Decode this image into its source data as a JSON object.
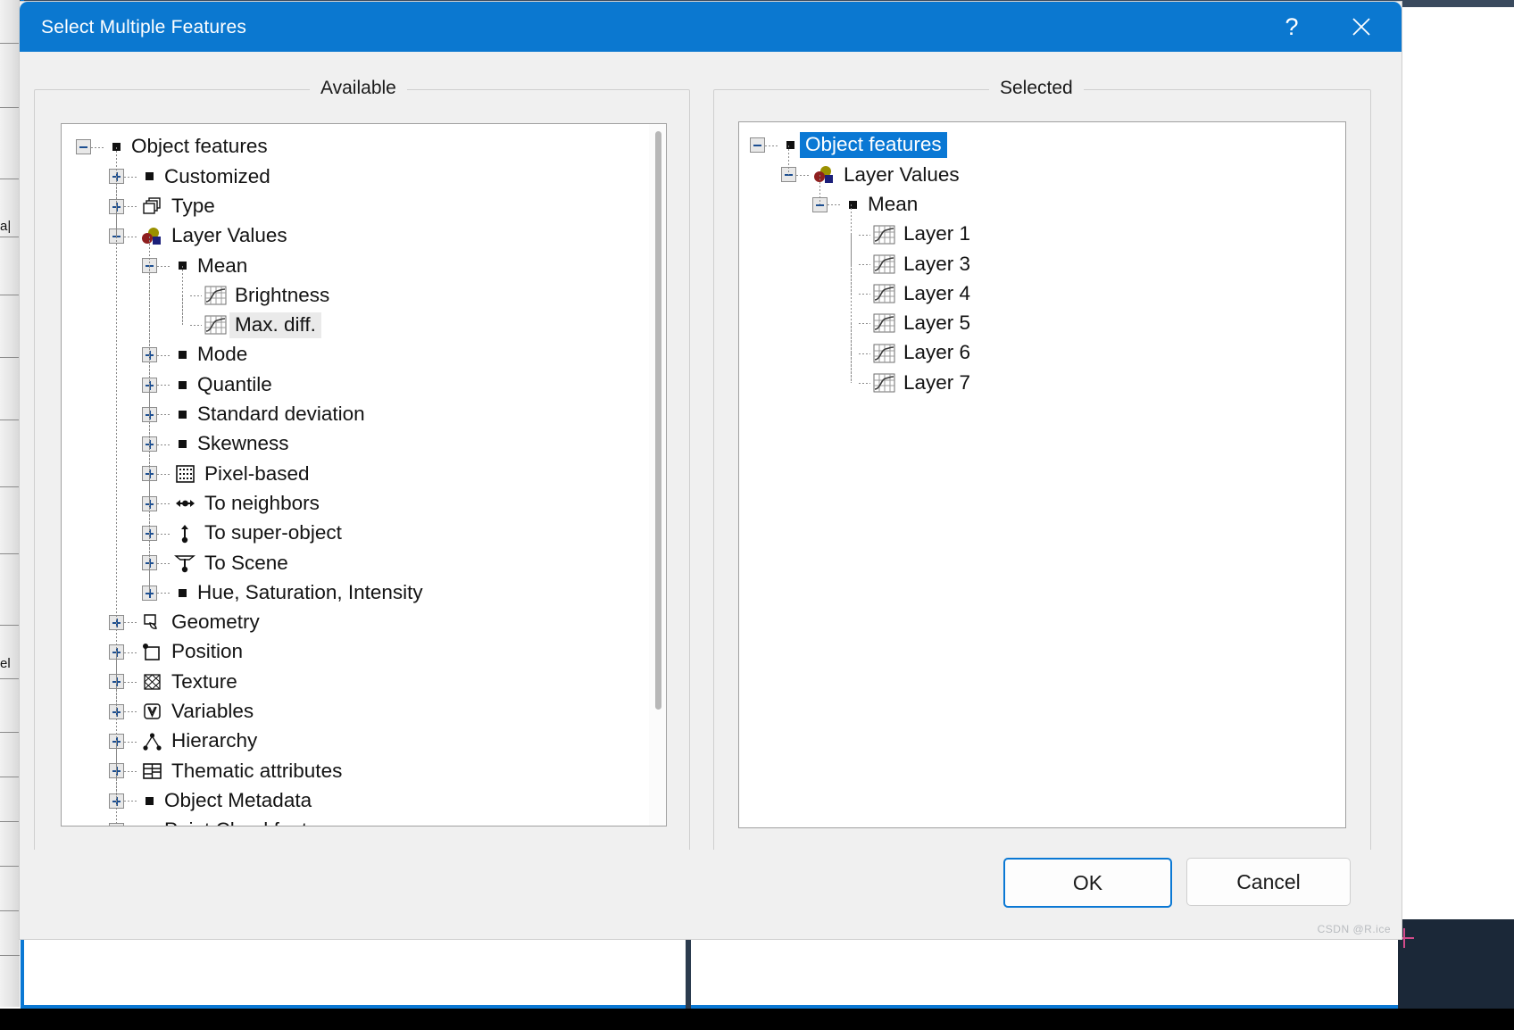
{
  "window": {
    "title": "Select Multiple Features",
    "help_label": "?",
    "close_label": "✕",
    "accent_color": "#0b78d0",
    "selection_color": "#0a78d4"
  },
  "panels": {
    "available_legend": "Available",
    "selected_legend": "Selected"
  },
  "available_tree": [
    {
      "label": "Object features",
      "depth": 0,
      "expander": "minus",
      "icon": "black-square-icon",
      "state": "normal"
    },
    {
      "label": "Customized",
      "depth": 1,
      "expander": "plus",
      "icon": "black-square-icon",
      "state": "normal"
    },
    {
      "label": "Type",
      "depth": 1,
      "expander": "plus",
      "icon": "copies-icon",
      "state": "normal"
    },
    {
      "label": "Layer Values",
      "depth": 1,
      "expander": "minus",
      "icon": "layer-values-icon",
      "state": "normal"
    },
    {
      "label": "Mean",
      "depth": 2,
      "expander": "minus",
      "icon": "black-square-icon",
      "state": "normal"
    },
    {
      "label": "Brightness",
      "depth": 3,
      "expander": "none",
      "icon": "curve-graph-icon",
      "state": "normal"
    },
    {
      "label": "Max. diff.",
      "depth": 3,
      "expander": "none",
      "icon": "curve-graph-icon",
      "state": "highlighted"
    },
    {
      "label": "Mode",
      "depth": 2,
      "expander": "plus",
      "icon": "black-square-icon",
      "state": "normal"
    },
    {
      "label": "Quantile",
      "depth": 2,
      "expander": "plus",
      "icon": "black-square-icon",
      "state": "normal"
    },
    {
      "label": "Standard deviation",
      "depth": 2,
      "expander": "plus",
      "icon": "black-square-icon",
      "state": "normal"
    },
    {
      "label": "Skewness",
      "depth": 2,
      "expander": "plus",
      "icon": "black-square-icon",
      "state": "normal"
    },
    {
      "label": "Pixel-based",
      "depth": 2,
      "expander": "plus",
      "icon": "pixel-grid-icon",
      "state": "normal"
    },
    {
      "label": "To neighbors",
      "depth": 2,
      "expander": "plus",
      "icon": "arrows-horizontal-icon",
      "state": "normal"
    },
    {
      "label": "To super-object",
      "depth": 2,
      "expander": "plus",
      "icon": "arrow-up-pin-icon",
      "state": "normal"
    },
    {
      "label": "To Scene",
      "depth": 2,
      "expander": "plus",
      "icon": "to-scene-icon",
      "state": "normal"
    },
    {
      "label": "Hue, Saturation, Intensity",
      "depth": 2,
      "expander": "plus",
      "icon": "black-square-icon",
      "state": "normal"
    },
    {
      "label": "Geometry",
      "depth": 1,
      "expander": "plus",
      "icon": "geometry-icon",
      "state": "normal"
    },
    {
      "label": "Position",
      "depth": 1,
      "expander": "plus",
      "icon": "position-icon",
      "state": "normal"
    },
    {
      "label": "Texture",
      "depth": 1,
      "expander": "plus",
      "icon": "texture-icon",
      "state": "normal"
    },
    {
      "label": "Variables",
      "depth": 1,
      "expander": "plus",
      "icon": "variables-icon",
      "state": "normal"
    },
    {
      "label": "Hierarchy",
      "depth": 1,
      "expander": "plus",
      "icon": "hierarchy-icon",
      "state": "normal"
    },
    {
      "label": "Thematic attributes",
      "depth": 1,
      "expander": "plus",
      "icon": "table-icon",
      "state": "normal"
    },
    {
      "label": "Object Metadata",
      "depth": 1,
      "expander": "plus",
      "icon": "black-square-icon",
      "state": "normal"
    },
    {
      "label": "Point Cloud features",
      "depth": 1,
      "expander": "plus",
      "icon": "black-square-icon",
      "state": "normal"
    }
  ],
  "selected_tree": [
    {
      "label": "Object features",
      "depth": 0,
      "expander": "minus",
      "icon": "black-square-icon",
      "state": "selected"
    },
    {
      "label": "Layer Values",
      "depth": 1,
      "expander": "minus",
      "icon": "layer-values-icon",
      "state": "normal"
    },
    {
      "label": "Mean",
      "depth": 2,
      "expander": "minus",
      "icon": "black-square-icon",
      "state": "normal"
    },
    {
      "label": "Layer 1",
      "depth": 3,
      "expander": "none",
      "icon": "curve-graph-icon",
      "state": "normal"
    },
    {
      "label": "Layer 3",
      "depth": 3,
      "expander": "none",
      "icon": "curve-graph-icon",
      "state": "normal"
    },
    {
      "label": "Layer 4",
      "depth": 3,
      "expander": "none",
      "icon": "curve-graph-icon",
      "state": "normal"
    },
    {
      "label": "Layer 5",
      "depth": 3,
      "expander": "none",
      "icon": "curve-graph-icon",
      "state": "normal"
    },
    {
      "label": "Layer 6",
      "depth": 3,
      "expander": "none",
      "icon": "curve-graph-icon",
      "state": "normal"
    },
    {
      "label": "Layer 7",
      "depth": 3,
      "expander": "none",
      "icon": "curve-graph-icon",
      "state": "normal"
    }
  ],
  "footer": {
    "ok_label": "OK",
    "cancel_label": "Cancel"
  },
  "watermark": "CSDN @R.ice"
}
